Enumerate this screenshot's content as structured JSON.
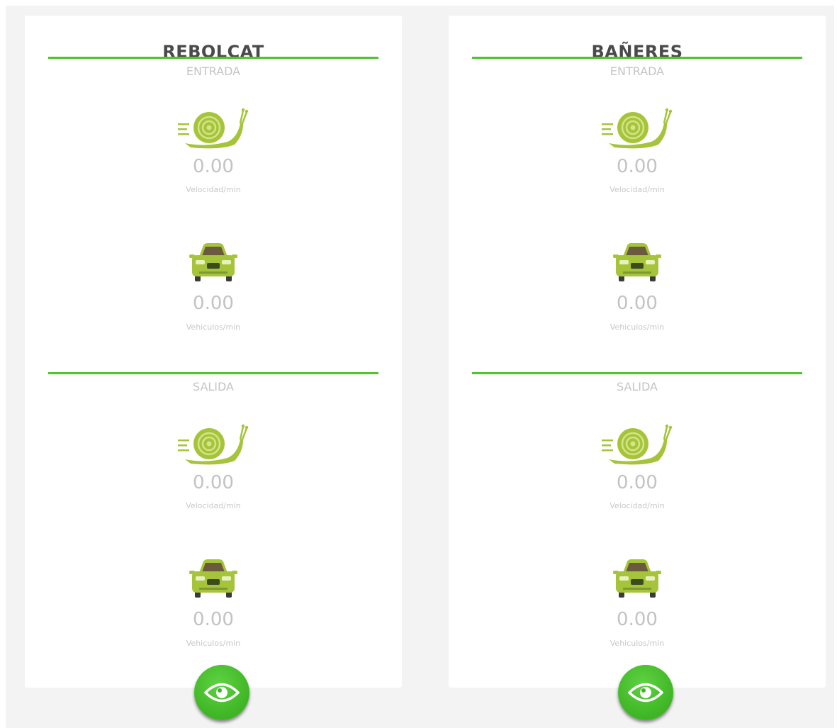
{
  "colors": {
    "accent": "#52c234",
    "icon": "#a5c43a",
    "muted": "#c3c3c3"
  },
  "cards": [
    {
      "title": "REBOLCAT",
      "entrada": {
        "label": "ENTRADA",
        "speed": {
          "icon": "snail-icon",
          "value": "0.00",
          "unit": "Velocidad/min"
        },
        "vehicles": {
          "icon": "car-icon",
          "value": "0.00",
          "unit": "Vehiculos/min"
        }
      },
      "salida": {
        "label": "SALIDA",
        "speed": {
          "icon": "snail-icon",
          "value": "0.00",
          "unit": "Velocidad/min"
        },
        "vehicles": {
          "icon": "car-icon",
          "value": "0.00",
          "unit": "Vehiculos/min"
        }
      },
      "action_icon": "eye-icon"
    },
    {
      "title": "BAÑERES",
      "entrada": {
        "label": "ENTRADA",
        "speed": {
          "icon": "snail-icon",
          "value": "0.00",
          "unit": "Velocidad/min"
        },
        "vehicles": {
          "icon": "car-icon",
          "value": "0.00",
          "unit": "Vehiculos/min"
        }
      },
      "salida": {
        "label": "SALIDA",
        "speed": {
          "icon": "snail-icon",
          "value": "0.00",
          "unit": "Velocidad/min"
        },
        "vehicles": {
          "icon": "car-icon",
          "value": "0.00",
          "unit": "Vehiculos/min"
        }
      },
      "action_icon": "eye-icon"
    }
  ]
}
